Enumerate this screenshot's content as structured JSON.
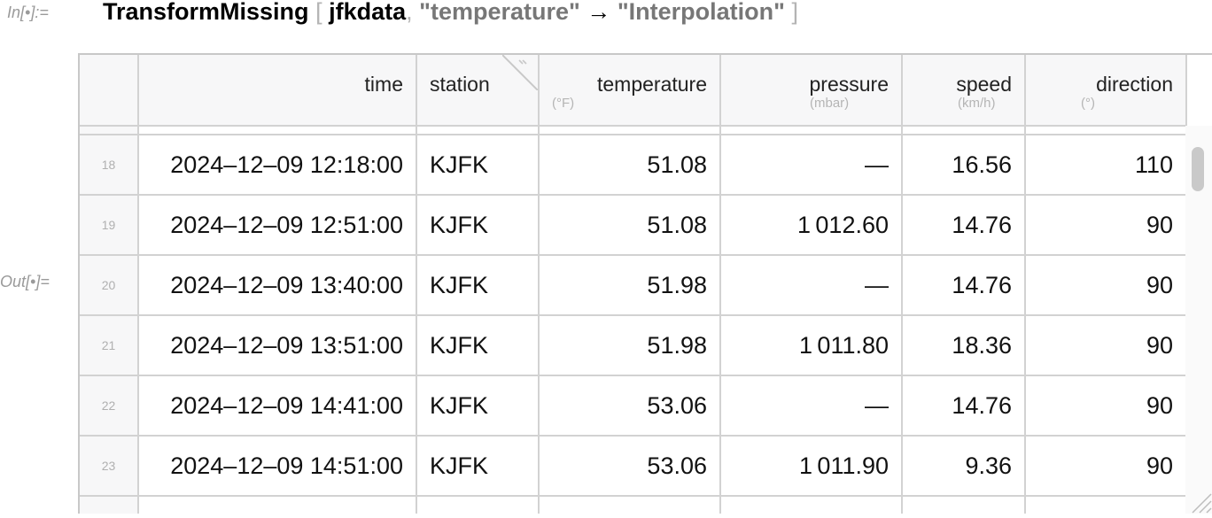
{
  "cell": {
    "in_label": "In[•]:=",
    "out_label": "Out[•]=",
    "code": {
      "func": "TransformMissing",
      "open_bracket": "[",
      "arg1": "jfkdata",
      "comma": ",",
      "key": "\"temperature\"",
      "arrow": "→",
      "value": "\"Interpolation\"",
      "close_bracket": "]"
    }
  },
  "table": {
    "columns": [
      {
        "name": "time",
        "unit": ""
      },
      {
        "name": "station",
        "unit": ""
      },
      {
        "name": "temperature",
        "unit": "(°F)"
      },
      {
        "name": "pressure",
        "unit": "(mbar)"
      },
      {
        "name": "speed",
        "unit": "(km/h)"
      },
      {
        "name": "direction",
        "unit": "(°)"
      }
    ],
    "rows": [
      {
        "index": "18",
        "time": "2024–12–09 12:18:00",
        "station": "KJFK",
        "temperature": "51.08",
        "pressure": "—",
        "speed": "16.56",
        "direction": "110"
      },
      {
        "index": "19",
        "time": "2024–12–09 12:51:00",
        "station": "KJFK",
        "temperature": "51.08",
        "pressure": "1 012.60",
        "speed": "14.76",
        "direction": "90"
      },
      {
        "index": "20",
        "time": "2024–12–09 13:40:00",
        "station": "KJFK",
        "temperature": "51.98",
        "pressure": "—",
        "speed": "14.76",
        "direction": "90"
      },
      {
        "index": "21",
        "time": "2024–12–09 13:51:00",
        "station": "KJFK",
        "temperature": "51.98",
        "pressure": "1 011.80",
        "speed": "18.36",
        "direction": "90"
      },
      {
        "index": "22",
        "time": "2024–12–09 14:41:00",
        "station": "KJFK",
        "temperature": "53.06",
        "pressure": "—",
        "speed": "14.76",
        "direction": "90"
      },
      {
        "index": "23",
        "time": "2024–12–09 14:51:00",
        "station": "KJFK",
        "temperature": "53.06",
        "pressure": "1 011.90",
        "speed": "9.36",
        "direction": "90"
      }
    ]
  },
  "icons": {
    "scroll_thumb": "scrollbar-thumb",
    "resize_grip": "resize-grip-icon",
    "column_menu": "column-menu-icon"
  },
  "colors": {
    "header_bg": "#f7f7f8",
    "grid_line": "#d2d2d2",
    "label_gray": "#9a9a9a"
  }
}
